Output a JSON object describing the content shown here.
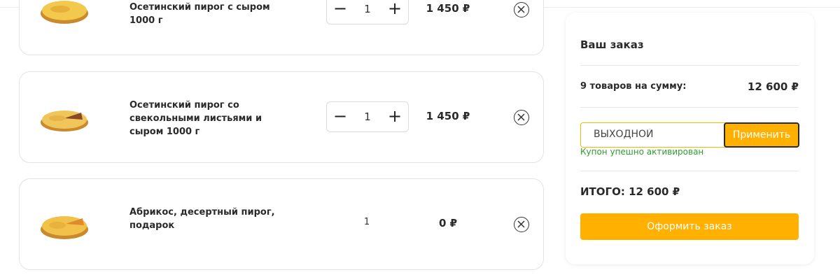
{
  "cart": {
    "items": [
      {
        "name": "Осетинский пирог с сыром 1000 г",
        "qty": "1",
        "price": "1 450 ₽",
        "adjustable": true
      },
      {
        "name": "Осетинский пирог со свекольными листьями и сыром 1000 г",
        "qty": "1",
        "price": "1 450 ₽",
        "adjustable": true
      },
      {
        "name": "Абрикос, десертный пирог, подарок",
        "qty": "1",
        "price": "0 ₽",
        "adjustable": false
      }
    ],
    "minus_symbol": "−",
    "plus_symbol": "+"
  },
  "summary": {
    "title": "Ваш заказ",
    "count_label": "9 товаров на сумму:",
    "sum": "12 600 ₽",
    "coupon_value": "ВЫХОДНОЙ",
    "apply_label": "Применить",
    "coupon_success": "Купон упешно активирован",
    "total": "ИТОГО: 12 600 ₽",
    "checkout_label": "Оформить заказ"
  },
  "colors": {
    "accent": "#ffb000",
    "success": "#2e9b2e",
    "border": "#e3e3e3"
  },
  "icons": [
    "pie-image",
    "minus-icon",
    "plus-icon",
    "remove-icon"
  ]
}
